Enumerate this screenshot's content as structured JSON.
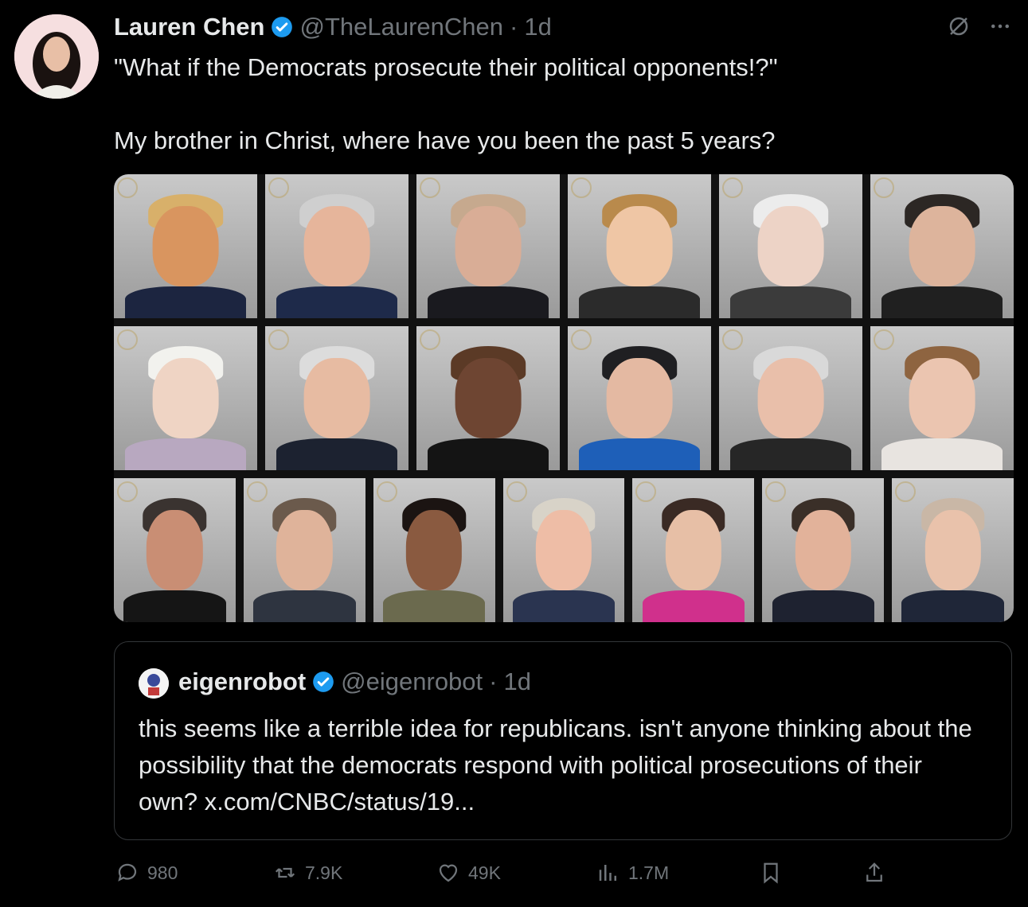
{
  "author": {
    "name": "Lauren Chen",
    "handle": "@TheLaurenChen",
    "time": "1d"
  },
  "tweet": {
    "line1": "\"What if the Democrats prosecute their political opponents!?\"",
    "line2": "My brother in Christ, where have you been the past 5 years?"
  },
  "quoted": {
    "name": "eigenrobot",
    "handle": "@eigenrobot",
    "time": "1d",
    "text": "this seems like a terrible idea for republicans. isn't anyone thinking about the possibility that the democrats respond with political prosecutions of their own? x.com/CNBC/status/19..."
  },
  "stats": {
    "replies": "980",
    "reposts": "7.9K",
    "likes": "49K",
    "views": "1.7M"
  },
  "icons": [
    "verified-badge-icon",
    "grok-icon",
    "more-icon",
    "reply-icon",
    "repost-icon",
    "like-icon",
    "views-icon",
    "bookmark-icon",
    "share-icon"
  ],
  "colors": {
    "background": "#000000",
    "text": "#e7e9ea",
    "muted": "#71767b",
    "verified": "#1d9bf0",
    "border": "#333639"
  }
}
